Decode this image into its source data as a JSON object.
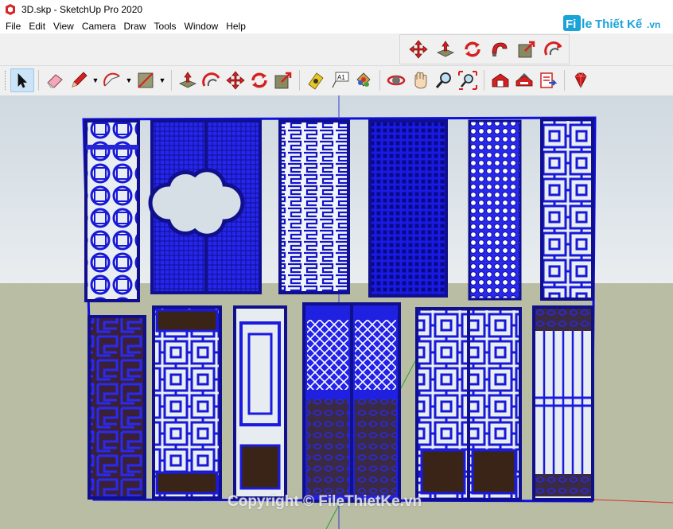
{
  "window": {
    "title": "3D.skp - SketchUp Pro 2020"
  },
  "menu": {
    "items": [
      "File",
      "Edit",
      "View",
      "Camera",
      "Draw",
      "Tools",
      "Window",
      "Help"
    ]
  },
  "watermark": {
    "logo_text": "FileThiếtKế.vn",
    "copyright": "Copyright © FileThietKe.vn"
  },
  "floating_toolbar": {
    "tools": [
      "move-icon",
      "push-pull-icon",
      "rotate-icon",
      "follow-me-icon",
      "scale-icon",
      "offset-icon"
    ]
  },
  "main_toolbar": {
    "tools": [
      "select-icon",
      "eraser-icon",
      "pencil-icon",
      "arc-icon",
      "rectangle-icon",
      "push-pull-icon",
      "offset-icon",
      "move-icon",
      "rotate-icon",
      "scale-icon",
      "tape-measure-icon",
      "text-icon",
      "paint-bucket-icon",
      "orbit-icon",
      "pan-icon",
      "zoom-icon",
      "zoom-extents-icon",
      "warehouse-icon",
      "share-model-icon",
      "extension-warehouse-icon",
      "ruby-icon"
    ],
    "text_icon_label": "A1"
  },
  "colors": {
    "panel_blue": "#2020e0",
    "frame_dark": "#14148c",
    "wood_dark": "#3a2418",
    "red_tool": "#d42020",
    "sky_top": "#cfd9e0",
    "ground": "#b8bda4"
  }
}
